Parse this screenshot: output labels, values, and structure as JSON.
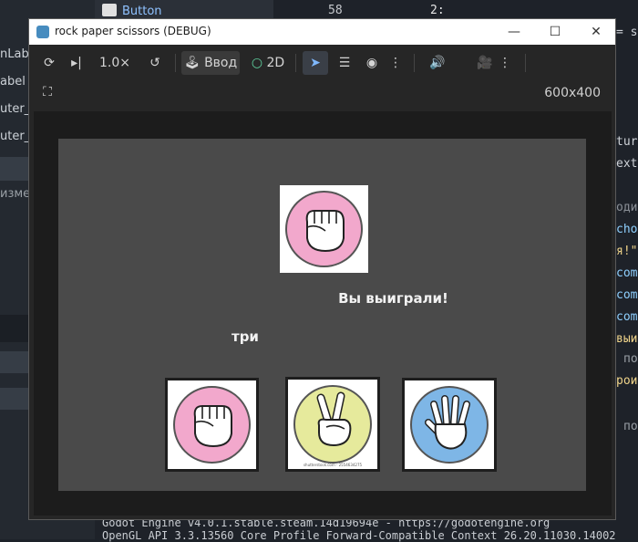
{
  "background": {
    "left_panel": [
      "nLab",
      "abel",
      "uter_c",
      "uter_c",
      "изме"
    ],
    "top_node_label": "Button",
    "line_number": "58",
    "code_fragment": "2:",
    "right_code": [
      "= s",
      "tur",
      "ext",
      "оди",
      "cho",
      "я!\"",
      "com",
      "com",
      "com",
      "выи",
      "по",
      "рои",
      "по"
    ],
    "console_lines": [
      "Godot Engine v4.0.1.stable.steam.14d19694e - https://godotengine.org",
      "OpenGL API 3.3.13560 Core Profile Forward-Compatible Context 26.20.11030.14002"
    ]
  },
  "window": {
    "title": "rock paper scissors (DEBUG)",
    "controls": {
      "minimize": "—",
      "maximize": "☐",
      "close": "✕"
    }
  },
  "toolbar": {
    "speed": "1.0×",
    "input_label": "Ввод",
    "mode_2d": "2D",
    "resolution": "600x400"
  },
  "game": {
    "result_text": "Вы выиграли!",
    "count_text": "три",
    "computer_choice": "rock",
    "player_choices": [
      "rock",
      "scissors",
      "paper"
    ],
    "watermark": "shutterstock.com · 2554634275"
  },
  "colors": {
    "rock_circle": "#f2a8cc",
    "scissors_circle": "#e6ea9c",
    "paper_circle": "#7eb6e6",
    "game_bg": "#4a4a4a"
  }
}
